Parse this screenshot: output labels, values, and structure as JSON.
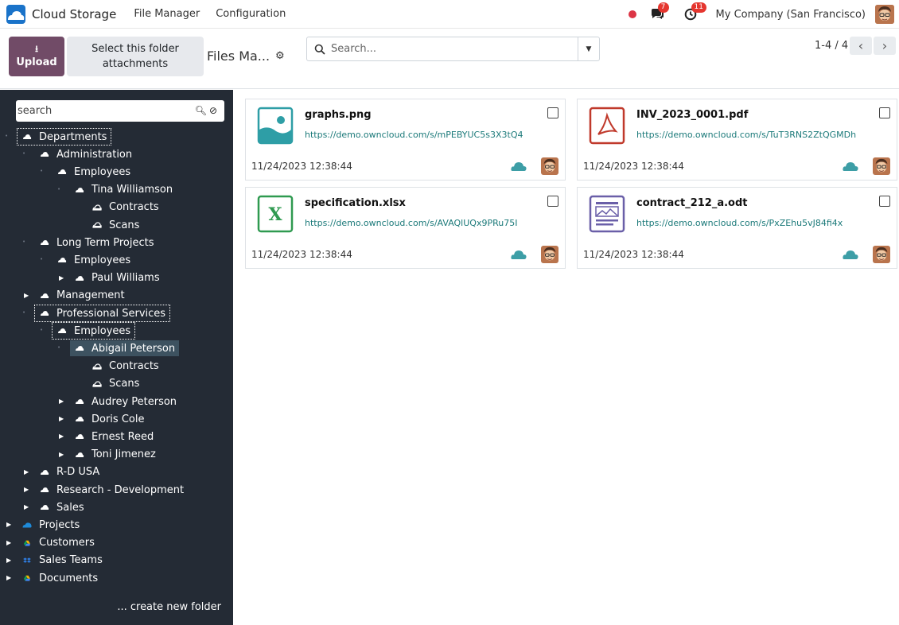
{
  "navbar": {
    "app_title": "Cloud Storage",
    "menu": [
      "File Manager",
      "Configuration"
    ],
    "messages_count": "7",
    "activities_count": "11",
    "company": "My Company (San Francisco)"
  },
  "control": {
    "upload_label": "Upload",
    "select_folder_label": "Select this folder attachments",
    "breadcrumb": "Files Ma...",
    "search_placeholder": "Search...",
    "pager": "1-4 / 4"
  },
  "sidebar": {
    "search_placeholder": "search",
    "create_folder": "... create new folder",
    "tree": [
      {
        "label": "Departments"
      },
      {
        "label": "Administration"
      },
      {
        "label": "Employees"
      },
      {
        "label": "Tina Williamson"
      },
      {
        "label": "Contracts"
      },
      {
        "label": "Scans"
      },
      {
        "label": "Long Term Projects"
      },
      {
        "label": "Employees"
      },
      {
        "label": "Paul Williams"
      },
      {
        "label": "Management"
      },
      {
        "label": "Professional Services"
      },
      {
        "label": "Employees"
      },
      {
        "label": "Abigail Peterson"
      },
      {
        "label": "Contracts"
      },
      {
        "label": "Scans"
      },
      {
        "label": "Audrey Peterson"
      },
      {
        "label": "Doris Cole"
      },
      {
        "label": "Ernest Reed"
      },
      {
        "label": "Toni Jimenez"
      },
      {
        "label": "R-D USA"
      },
      {
        "label": "Research - Development"
      },
      {
        "label": "Sales"
      },
      {
        "label": "Projects"
      },
      {
        "label": "Customers"
      },
      {
        "label": "Sales Teams"
      },
      {
        "label": "Documents"
      }
    ]
  },
  "files": [
    {
      "name": "graphs.png",
      "url": "https://demo.owncloud.com/s/mPEBYUC5s3X3tQ4",
      "date": "11/24/2023 12:38:44",
      "type": "image"
    },
    {
      "name": "INV_2023_0001.pdf",
      "url": "https://demo.owncloud.com/s/TuT3RNS2ZtQGMDh",
      "date": "11/24/2023 12:38:44",
      "type": "pdf"
    },
    {
      "name": "specification.xlsx",
      "url": "https://demo.owncloud.com/s/AVAQlUQx9PRu75I",
      "date": "11/24/2023 12:38:44",
      "type": "spreadsheet"
    },
    {
      "name": "contract_212_a.odt",
      "url": "https://demo.owncloud.com/s/PxZEhu5vJ84fi4x",
      "date": "11/24/2023 12:38:44",
      "type": "document"
    }
  ],
  "colors": {
    "brand": "#714b67",
    "sidebar_bg": "#242b35",
    "link": "#1c7a7a",
    "cloud": "#3d9ea6",
    "badge": "#e5362f"
  }
}
